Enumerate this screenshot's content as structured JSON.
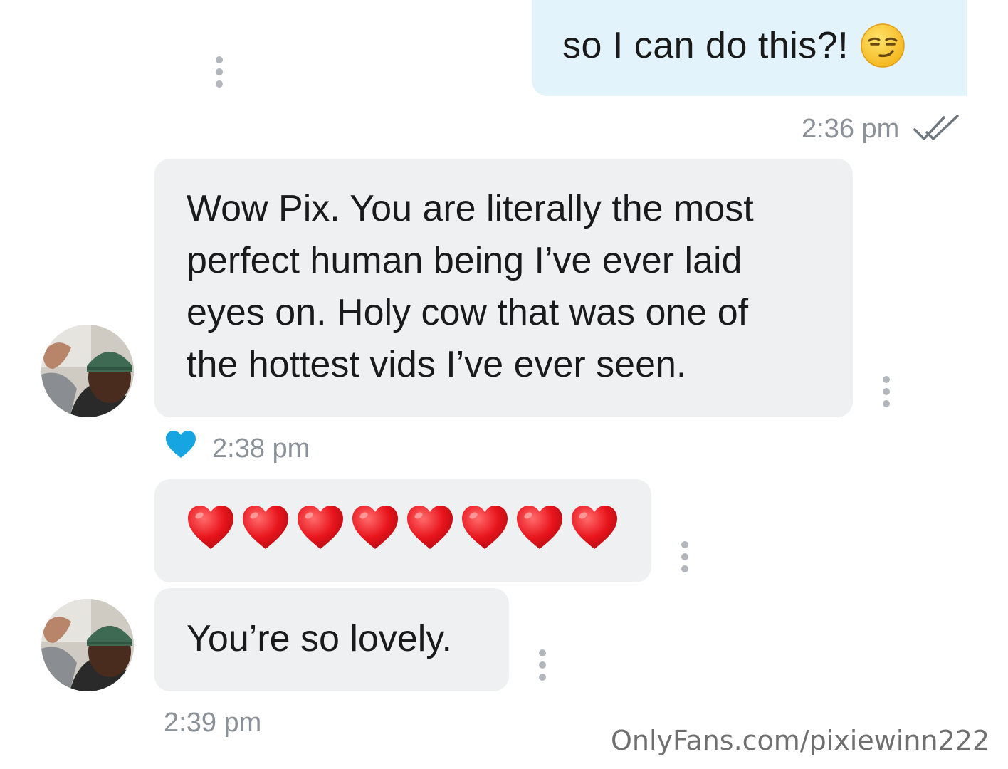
{
  "messages": [
    {
      "text": "so I can do this?!",
      "emoji": "smirking-face",
      "time": "2:36 pm",
      "status": "read"
    },
    {
      "text_lines": [
        "Wow Pix. You are literally the most",
        "perfect human being I’ve ever laid",
        "eyes on. Holy cow that was one of",
        "the hottest vids I’ve ever seen."
      ],
      "time": "2:38 pm",
      "liked": true
    },
    {
      "hearts": 8,
      "emoji": "red-heart"
    },
    {
      "text": "You’re so lovely.",
      "time": "2:39 pm"
    }
  ],
  "watermark": "OnlyFans.com/pixiewinn222",
  "colors": {
    "outgoing_bubble": "#e3f3fb",
    "incoming_bubble": "#eef0f2",
    "like_heart": "#16a5e1",
    "timestamp": "#8a9198"
  },
  "icons": [
    "more-options-icon",
    "double-check-icon",
    "like-heart-icon",
    "avatar"
  ]
}
